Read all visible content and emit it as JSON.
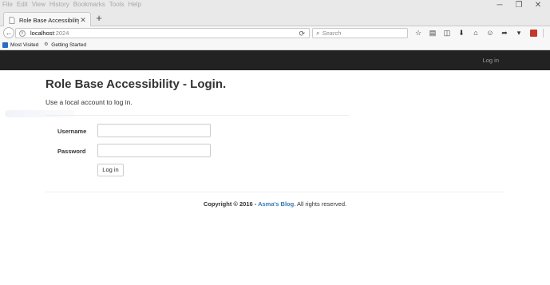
{
  "browser": {
    "menu": [
      "File",
      "Edit",
      "View",
      "History",
      "Bookmarks",
      "Tools",
      "Help"
    ],
    "window_controls": {
      "minimize": "─",
      "restore": "❐",
      "close": "✕"
    },
    "tab": {
      "title": "Role Base Accessibility - L...",
      "close": "✕"
    },
    "new_tab": "+",
    "url": {
      "host": "localhost",
      "port": ":2024"
    },
    "search": {
      "placeholder": "Search"
    },
    "bookmarks": [
      {
        "label": "Most Visited",
        "icon": "bookmark-folder-icon"
      },
      {
        "label": "Getting Started",
        "icon": "gear-icon"
      }
    ],
    "toolbar_icons": [
      "star-icon",
      "reading-list-icon",
      "pocket-icon",
      "download-icon",
      "home-icon",
      "chat-icon",
      "send-icon",
      "dropdown-icon",
      "extension-icon",
      "menu-icon"
    ]
  },
  "site": {
    "header": {
      "login_link": "Log in"
    },
    "title": "Role Base Accessibility - Login.",
    "subtitle": "Use a local account to log in.",
    "form": {
      "username_label": "Username",
      "username_value": "",
      "password_label": "Password",
      "password_value": "",
      "submit_label": "Log in"
    },
    "footer": {
      "prefix": "Copyright © 2016 - ",
      "link": "Asma's Blog",
      "suffix": ". All rights reserved."
    }
  },
  "colors": {
    "header_bg": "#222222",
    "link": "#337ab7",
    "header_link": "#9d9d9d"
  }
}
